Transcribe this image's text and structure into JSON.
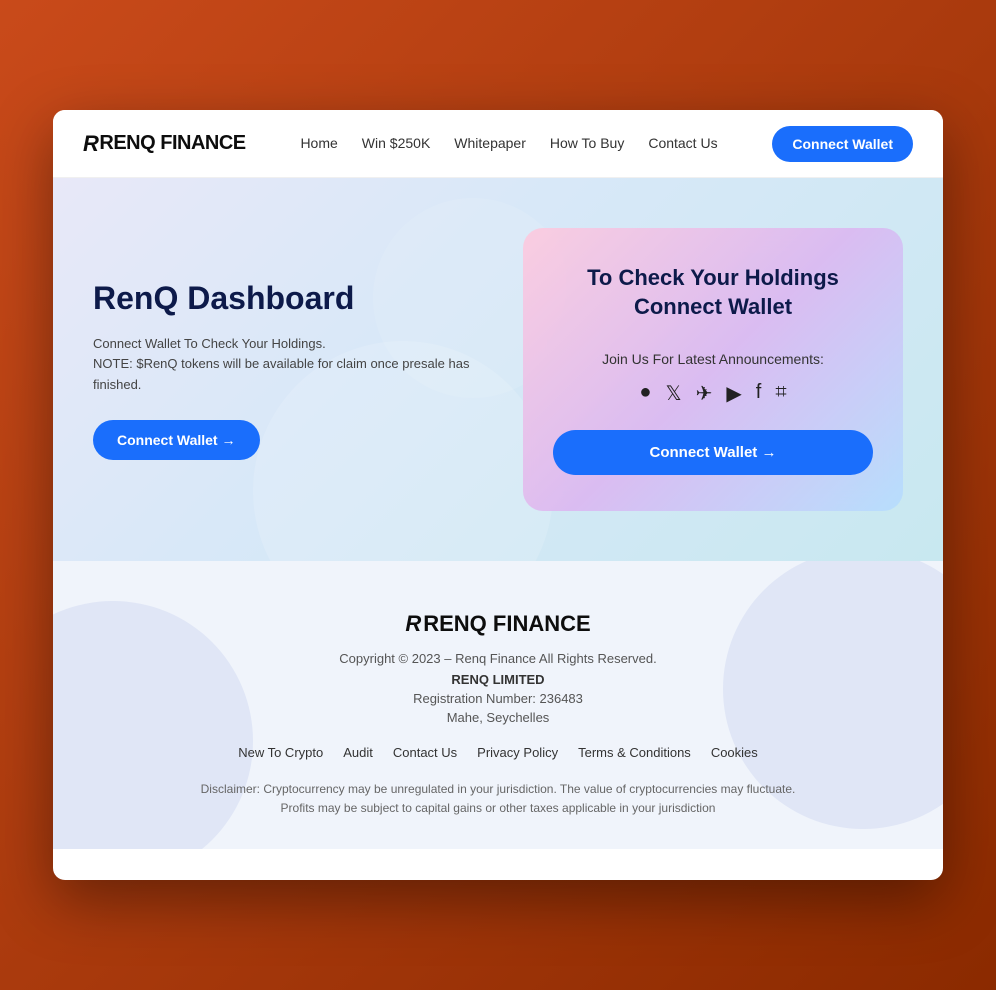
{
  "meta": {
    "bg_color_outer": "#c94a1a"
  },
  "navbar": {
    "logo": "RENQ FINANCE",
    "links": [
      {
        "id": "home",
        "label": "Home"
      },
      {
        "id": "win250k",
        "label": "Win $250K"
      },
      {
        "id": "whitepaper",
        "label": "Whitepaper"
      },
      {
        "id": "howtobuy",
        "label": "How To Buy"
      },
      {
        "id": "contact",
        "label": "Contact Us"
      }
    ],
    "connect_btn": "Connect Wallet"
  },
  "hero": {
    "title": "RenQ Dashboard",
    "description_line1": "Connect Wallet To Check Your Holdings.",
    "description_line2": "NOTE: $RenQ tokens will be available for claim once presale has finished.",
    "connect_btn": "Connect Wallet →"
  },
  "wallet_card": {
    "title": "To Check Your Holdings Connect Wallet",
    "join_text": "Join Us For Latest Announcements:",
    "social_icons": [
      "instagram",
      "twitter",
      "telegram",
      "youtube",
      "facebook",
      "discord"
    ],
    "connect_btn": "Connect Wallet →"
  },
  "footer": {
    "logo": "RENQ FINANCE",
    "copyright": "Copyright © 2023 – Renq Finance All Rights Reserved.",
    "company_name": "RENQ LIMITED",
    "registration": "Registration Number: 236483",
    "location": "Mahe, Seychelles",
    "links": [
      {
        "id": "new-crypto",
        "label": "New To Crypto"
      },
      {
        "id": "audit",
        "label": "Audit"
      },
      {
        "id": "contact",
        "label": "Contact Us"
      },
      {
        "id": "privacy",
        "label": "Privacy Policy"
      },
      {
        "id": "terms",
        "label": "Terms & Conditions"
      },
      {
        "id": "cookies",
        "label": "Cookies"
      }
    ],
    "disclaimer": "Disclaimer: Cryptocurrency may be unregulated in your jurisdiction. The value of cryptocurrencies may fluctuate. Profits may be subject to capital gains or other taxes applicable in your jurisdiction"
  }
}
